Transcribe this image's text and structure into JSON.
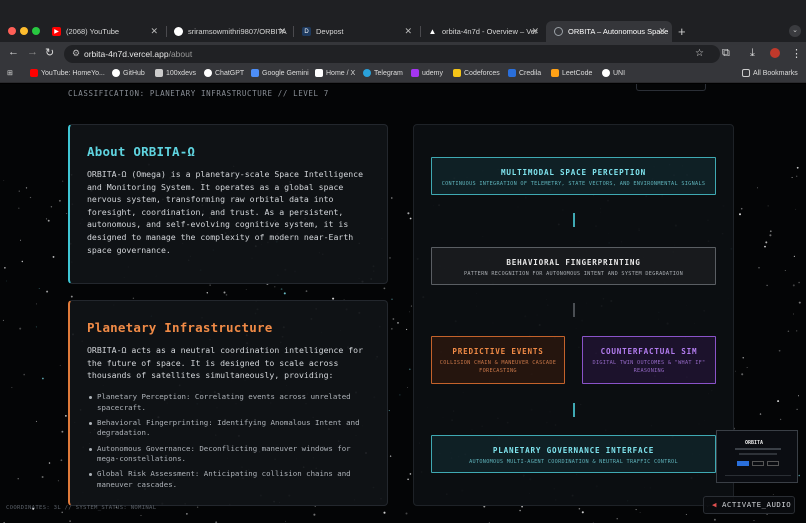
{
  "browser": {
    "tabs": [
      {
        "title": "(2068) YouTube",
        "icon": "youtube-icon",
        "color": "#ff0000"
      },
      {
        "title": "sriramsowmithri9807/ORBITA",
        "icon": "github-icon",
        "color": "#ffffff"
      },
      {
        "title": "Devpost",
        "icon": "devpost-icon",
        "color": "#1e3a5f"
      },
      {
        "title": "orbita-4n7d - Overview – Ver",
        "icon": "vercel-icon",
        "color": "#ffffff"
      },
      {
        "title": "ORBITA – Autonomous Space",
        "icon": "globe-icon",
        "color": "#9aa0a6",
        "active": true
      }
    ],
    "url_host": "orbita-4n7d.vercel.app",
    "url_path": "/about",
    "bookmarks": [
      {
        "label": "YouTube: HomeYo...",
        "icon": "youtube-icon",
        "color": "#ff0000"
      },
      {
        "label": "GitHub",
        "icon": "github-icon",
        "color": "#ffffff"
      },
      {
        "label": "100xdevs",
        "icon": "100xdevs-icon",
        "color": "#cccccc"
      },
      {
        "label": "ChatGPT",
        "icon": "chatgpt-icon",
        "color": "#ffffff"
      },
      {
        "label": "Google Gemini",
        "icon": "gemini-icon",
        "color": "#4d8ef7"
      },
      {
        "label": "Home / X",
        "icon": "x-icon",
        "color": "#ffffff"
      },
      {
        "label": "Telegram",
        "icon": "telegram-icon",
        "color": "#2aa1da"
      },
      {
        "label": "udemy",
        "icon": "udemy-icon",
        "color": "#a435f0"
      },
      {
        "label": "Codeforces",
        "icon": "codeforces-icon",
        "color": "#f5c518"
      },
      {
        "label": "Credila",
        "icon": "credila-icon",
        "color": "#2a6fdb"
      },
      {
        "label": "LeetCode",
        "icon": "leetcode-icon",
        "color": "#ffa116"
      },
      {
        "label": "UNI",
        "icon": "uni-icon",
        "color": "#ffffff"
      }
    ],
    "all_bookmarks": "All Bookmarks"
  },
  "page": {
    "classification": "CLASSIFICATION: PLANETARY INFRASTRUCTURE // LEVEL 7",
    "about": {
      "title": "About ORBITA-Ω",
      "body": "ORBITA-Ω (Omega) is a planetary-scale Space Intelligence and Monitoring System. It operates as a global space nervous system, transforming raw orbital data into foresight, coordination, and trust. As a persistent, autonomous, and self-evolving cognitive system, it is designed to manage the complexity of modern near-Earth space governance."
    },
    "infrastructure": {
      "title": "Planetary Infrastructure",
      "body": "ORBITA-Ω acts as a neutral coordination intelligence for the future of space. It is designed to scale across thousands of satellites simultaneously, providing:",
      "bullets": [
        "Planetary Perception: Correlating events across unrelated spacecraft.",
        "Behavioral Fingerprinting: Identifying Anomalous Intent and degradation.",
        "Autonomous Governance: Deconflicting maneuver windows for mega-constellations.",
        "Global Risk Assessment: Anticipating collision chains and maneuver cascades."
      ]
    },
    "diagram": {
      "perception": {
        "title": "MULTIMODAL SPACE PERCEPTION",
        "sub": "CONTINUOUS INTEGRATION OF TELEMETRY, STATE VECTORS, AND ENVIRONMENTAL SIGNALS"
      },
      "fingerprinting": {
        "title": "BEHAVIORAL FINGERPRINTING",
        "sub": "PATTERN RECOGNITION FOR AUTONOMOUS INTENT AND SYSTEM DEGRADATION"
      },
      "predictive": {
        "title": "PREDICTIVE EVENTS",
        "sub": "COLLISION CHAIN & MANEUVER CASCADE FORECASTING"
      },
      "counterfactual": {
        "title": "COUNTERFACTUAL SIM",
        "sub": "DIGITAL TWIN OUTCOMES & \"WHAT IF\" REASONING"
      },
      "governance": {
        "title": "PLANETARY GOVERNANCE INTERFACE",
        "sub": "AUTONOMOUS MULTI-AGENT COORDINATION & NEUTRAL TRAFFIC CONTROL"
      }
    },
    "activate_audio": "ACTIVATE_AUDIO",
    "status_line": "COORDINATES: 3L // SYSTEM_STATUS: NOMINAL",
    "minimap_title": "ORBITA"
  },
  "colors": {
    "cyan": "#3fc6d4",
    "orange": "#e07a3a",
    "purple": "#8a53c9"
  }
}
